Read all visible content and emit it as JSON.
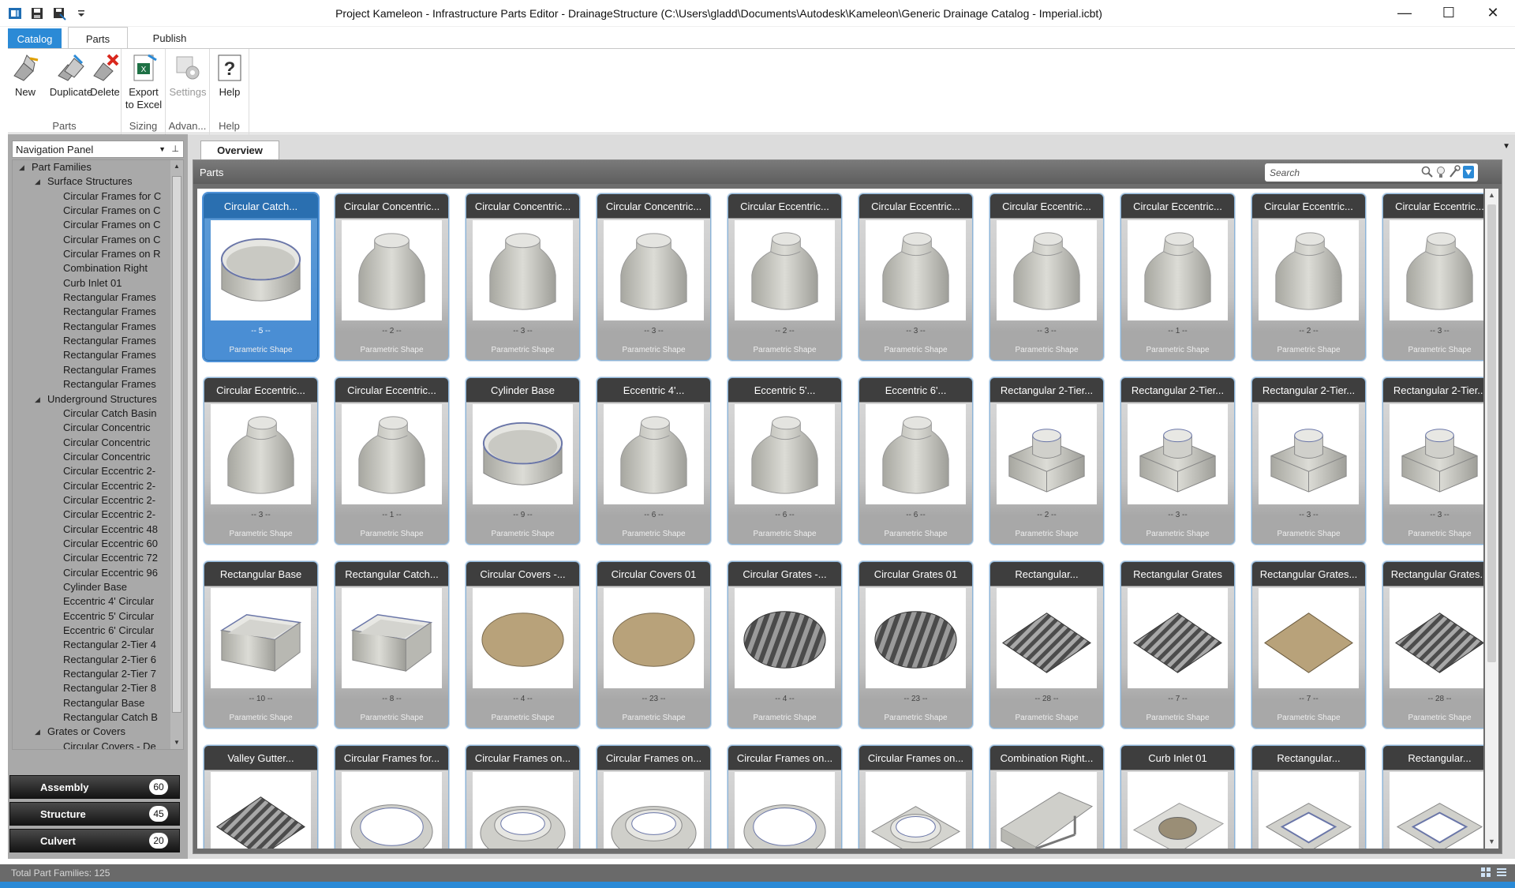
{
  "window": {
    "title": "Project Kameleon - Infrastructure Parts Editor - DrainageStructure (C:\\Users\\gladd\\Documents\\Autodesk\\Kameleon\\Generic Drainage Catalog - Imperial.icbt)",
    "minimize": "—",
    "maximize": "☐",
    "close": "✕"
  },
  "ribbon_tabs": {
    "catalog": "Catalog",
    "parts": "Parts",
    "publish": "Publish",
    "collapse": "⌃"
  },
  "ribbon": {
    "new": "New",
    "duplicate": "Duplicate",
    "delete": "Delete",
    "parts_group": "Parts",
    "export_1": "Export",
    "export_2": "to Excel",
    "sizing_group": "Sizing",
    "settings": "Settings",
    "advanced_group": "Advan...",
    "help": "Help",
    "help_group": "Help"
  },
  "nav": {
    "title": "Navigation Panel",
    "tree": [
      {
        "label": "Part Families",
        "level": 0,
        "expanded": true
      },
      {
        "label": "Surface Structures",
        "level": 1,
        "expanded": true
      },
      {
        "label": "Circular Frames for C",
        "level": 2
      },
      {
        "label": "Circular Frames on C",
        "level": 2
      },
      {
        "label": "Circular Frames on C",
        "level": 2
      },
      {
        "label": "Circular Frames on C",
        "level": 2
      },
      {
        "label": "Circular Frames on R",
        "level": 2
      },
      {
        "label": "Combination Right",
        "level": 2
      },
      {
        "label": "Curb Inlet 01",
        "level": 2
      },
      {
        "label": "Rectangular Frames",
        "level": 2
      },
      {
        "label": "Rectangular Frames",
        "level": 2
      },
      {
        "label": "Rectangular Frames",
        "level": 2
      },
      {
        "label": "Rectangular Frames",
        "level": 2
      },
      {
        "label": "Rectangular Frames",
        "level": 2
      },
      {
        "label": "Rectangular Frames",
        "level": 2
      },
      {
        "label": "Rectangular Frames",
        "level": 2
      },
      {
        "label": "Underground Structures",
        "level": 1,
        "expanded": true
      },
      {
        "label": "Circular Catch Basin",
        "level": 2
      },
      {
        "label": "Circular Concentric",
        "level": 2
      },
      {
        "label": "Circular Concentric",
        "level": 2
      },
      {
        "label": "Circular Concentric",
        "level": 2
      },
      {
        "label": "Circular Eccentric 2-",
        "level": 2
      },
      {
        "label": "Circular Eccentric 2-",
        "level": 2
      },
      {
        "label": "Circular Eccentric 2-",
        "level": 2
      },
      {
        "label": "Circular Eccentric 2-",
        "level": 2
      },
      {
        "label": "Circular Eccentric 48",
        "level": 2
      },
      {
        "label": "Circular Eccentric 60",
        "level": 2
      },
      {
        "label": "Circular Eccentric 72",
        "level": 2
      },
      {
        "label": "Circular Eccentric 96",
        "level": 2
      },
      {
        "label": "Cylinder Base",
        "level": 2
      },
      {
        "label": "Eccentric 4' Circular",
        "level": 2
      },
      {
        "label": "Eccentric 5' Circular",
        "level": 2
      },
      {
        "label": "Eccentric 6' Circular",
        "level": 2
      },
      {
        "label": "Rectangular 2-Tier 4",
        "level": 2
      },
      {
        "label": "Rectangular 2-Tier 6",
        "level": 2
      },
      {
        "label": "Rectangular 2-Tier 7",
        "level": 2
      },
      {
        "label": "Rectangular 2-Tier 8",
        "level": 2
      },
      {
        "label": "Rectangular Base",
        "level": 2
      },
      {
        "label": "Rectangular Catch B",
        "level": 2
      },
      {
        "label": "Grates or Covers",
        "level": 1,
        "expanded": true
      },
      {
        "label": "Circular Covers - De",
        "level": 2
      }
    ],
    "categories": [
      {
        "label": "Assembly",
        "count": "60"
      },
      {
        "label": "Structure",
        "count": "45"
      },
      {
        "label": "Culvert",
        "count": "20"
      }
    ]
  },
  "main": {
    "tab": "Overview",
    "header": "Parts",
    "search_placeholder": "Search",
    "cards": [
      {
        "title": "Circular Catch...",
        "count": "-- 5 --",
        "shape": "Parametric Shape",
        "icon": "cylinder-open",
        "selected": true
      },
      {
        "title": "Circular Concentric...",
        "count": "-- 2 --",
        "shape": "Parametric Shape",
        "icon": "cone"
      },
      {
        "title": "Circular Concentric...",
        "count": "-- 3 --",
        "shape": "Parametric Shape",
        "icon": "cone"
      },
      {
        "title": "Circular Concentric...",
        "count": "-- 3 --",
        "shape": "Parametric Shape",
        "icon": "cone"
      },
      {
        "title": "Circular Eccentric...",
        "count": "-- 2 --",
        "shape": "Parametric Shape",
        "icon": "ecc-cone"
      },
      {
        "title": "Circular Eccentric...",
        "count": "-- 3 --",
        "shape": "Parametric Shape",
        "icon": "ecc-cone"
      },
      {
        "title": "Circular Eccentric...",
        "count": "-- 3 --",
        "shape": "Parametric Shape",
        "icon": "ecc-cone"
      },
      {
        "title": "Circular Eccentric...",
        "count": "-- 1 --",
        "shape": "Parametric Shape",
        "icon": "ecc-cone"
      },
      {
        "title": "Circular Eccentric...",
        "count": "-- 2 --",
        "shape": "Parametric Shape",
        "icon": "ecc-cone"
      },
      {
        "title": "Circular Eccentric...",
        "count": "-- 3 --",
        "shape": "Parametric Shape",
        "icon": "ecc-cone"
      },
      {
        "title": "Circular Eccentric...",
        "count": "-- 3 --",
        "shape": "Parametric Shape",
        "icon": "ecc-cone"
      },
      {
        "title": "Circular Eccentric...",
        "count": "-- 1 --",
        "shape": "Parametric Shape",
        "icon": "ecc-cone"
      },
      {
        "title": "Cylinder Base",
        "count": "-- 9 --",
        "shape": "Parametric Shape",
        "icon": "cylinder-open"
      },
      {
        "title": "Eccentric 4'...",
        "count": "-- 6 --",
        "shape": "Parametric Shape",
        "icon": "ecc-cone"
      },
      {
        "title": "Eccentric 5'...",
        "count": "-- 6 --",
        "shape": "Parametric Shape",
        "icon": "ecc-cone"
      },
      {
        "title": "Eccentric 6'...",
        "count": "-- 6 --",
        "shape": "Parametric Shape",
        "icon": "ecc-cone"
      },
      {
        "title": "Rectangular 2-Tier...",
        "count": "-- 2 --",
        "shape": "Parametric Shape",
        "icon": "box-cyl"
      },
      {
        "title": "Rectangular 2-Tier...",
        "count": "-- 3 --",
        "shape": "Parametric Shape",
        "icon": "box-cyl"
      },
      {
        "title": "Rectangular 2-Tier...",
        "count": "-- 3 --",
        "shape": "Parametric Shape",
        "icon": "box-cyl"
      },
      {
        "title": "Rectangular 2-Tier...",
        "count": "-- 3 --",
        "shape": "Parametric Shape",
        "icon": "box-cyl"
      },
      {
        "title": "Rectangular Base",
        "count": "-- 10 --",
        "shape": "Parametric Shape",
        "icon": "box-open"
      },
      {
        "title": "Rectangular Catch...",
        "count": "-- 8 --",
        "shape": "Parametric Shape",
        "icon": "box-open"
      },
      {
        "title": "Circular Covers -...",
        "count": "-- 4 --",
        "shape": "Parametric Shape",
        "icon": "disc-tan"
      },
      {
        "title": "Circular Covers 01",
        "count": "-- 23 --",
        "shape": "Parametric Shape",
        "icon": "disc-tan"
      },
      {
        "title": "Circular Grates -...",
        "count": "-- 4 --",
        "shape": "Parametric Shape",
        "icon": "disc-grate"
      },
      {
        "title": "Circular Grates 01",
        "count": "-- 23 --",
        "shape": "Parametric Shape",
        "icon": "disc-grate"
      },
      {
        "title": "Rectangular...",
        "count": "-- 28 --",
        "shape": "Parametric Shape",
        "icon": "plate-grate"
      },
      {
        "title": "Rectangular Grates",
        "count": "-- 7 --",
        "shape": "Parametric Shape",
        "icon": "plate-grate"
      },
      {
        "title": "Rectangular Grates...",
        "count": "-- 7 --",
        "shape": "Parametric Shape",
        "icon": "plate-tan"
      },
      {
        "title": "Rectangular Grates...",
        "count": "-- 28 --",
        "shape": "Parametric Shape",
        "icon": "plate-grate"
      },
      {
        "title": "Valley Gutter...",
        "count": "",
        "shape": "",
        "icon": "plate-grate"
      },
      {
        "title": "Circular Frames for...",
        "count": "",
        "shape": "",
        "icon": "ring"
      },
      {
        "title": "Circular Frames on...",
        "count": "",
        "shape": "",
        "icon": "ring-slab"
      },
      {
        "title": "Circular Frames on...",
        "count": "",
        "shape": "",
        "icon": "ring-slab"
      },
      {
        "title": "Circular Frames on...",
        "count": "",
        "shape": "",
        "icon": "ring"
      },
      {
        "title": "Circular Frames on...",
        "count": "",
        "shape": "",
        "icon": "ring-square"
      },
      {
        "title": "Combination Right...",
        "count": "",
        "shape": "",
        "icon": "combo"
      },
      {
        "title": "Curb Inlet 01",
        "count": "",
        "shape": "",
        "icon": "curb"
      },
      {
        "title": "Rectangular...",
        "count": "",
        "shape": "",
        "icon": "rect-frame"
      },
      {
        "title": "Rectangular...",
        "count": "",
        "shape": "",
        "icon": "rect-frame"
      }
    ]
  },
  "status": {
    "text": "Total Part Families:  125"
  },
  "colors": {
    "accent": "#2b8ad6",
    "selected_card": "#4a8ed4",
    "card_header": "#3e3e3e"
  }
}
